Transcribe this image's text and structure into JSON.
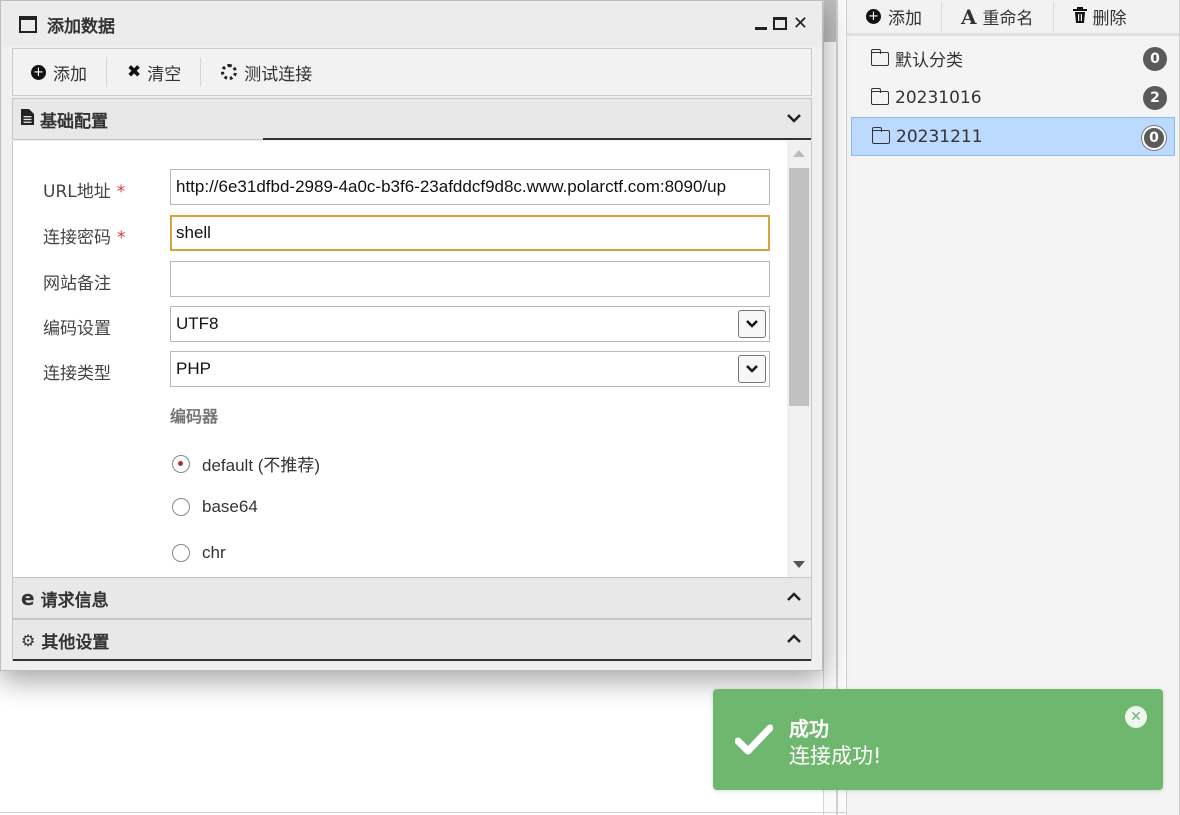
{
  "dialog": {
    "title": "添加数据",
    "toolbar": {
      "add_label": "添加",
      "clear_label": "清空",
      "test_label": "测试连接"
    },
    "sections": {
      "basic": "基础配置",
      "request": "请求信息",
      "other": "其他设置"
    },
    "form": {
      "url_label": "URL地址",
      "url_value": "http://6e31dfbd-2989-4a0c-b3f6-23afddcf9d8c.www.polarctf.com:8090/up",
      "password_label": "连接密码",
      "password_value": "shell",
      "note_label": "网站备注",
      "note_value": "",
      "encoding_label": "编码设置",
      "encoding_value": "UTF8",
      "type_label": "连接类型",
      "type_value": "PHP",
      "required_mark": "*",
      "encoder_header": "编码器",
      "encoders": [
        {
          "label": "default (不推荐)",
          "checked": true
        },
        {
          "label": "base64",
          "checked": false
        },
        {
          "label": "chr",
          "checked": false
        }
      ]
    }
  },
  "right_panel": {
    "toolbar": {
      "add_label": "添加",
      "rename_label": "重命名",
      "delete_label": "删除"
    },
    "categories": [
      {
        "name": "默认分类",
        "count": "0",
        "selected": false
      },
      {
        "name": "20231016",
        "count": "2",
        "selected": false
      },
      {
        "name": "20231211",
        "count": "0",
        "selected": true
      }
    ]
  },
  "toast": {
    "title": "成功",
    "message": "连接成功!",
    "color": "#6fb66f"
  }
}
